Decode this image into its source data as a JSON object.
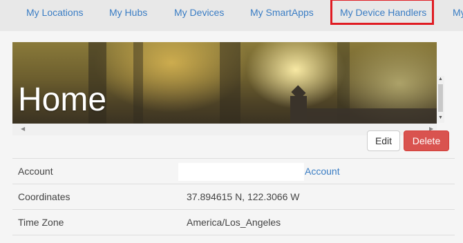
{
  "nav": {
    "items": [
      {
        "label": "My Locations"
      },
      {
        "label": "My Hubs"
      },
      {
        "label": "My Devices"
      },
      {
        "label": "My SmartApps"
      },
      {
        "label": "My Device Handlers"
      },
      {
        "label": "My"
      }
    ]
  },
  "location": {
    "title": "Home"
  },
  "actions": {
    "edit_label": "Edit",
    "delete_label": "Delete"
  },
  "details": {
    "account_label": "Account",
    "account_link": "Account",
    "coordinates_label": "Coordinates",
    "coordinates_value": "37.894615 N, 122.3066 W",
    "timezone_label": "Time Zone",
    "timezone_value": "America/Los_Angeles"
  },
  "colors": {
    "link": "#3a7dc4",
    "highlight": "#e01b22",
    "danger": "#d9534f"
  }
}
